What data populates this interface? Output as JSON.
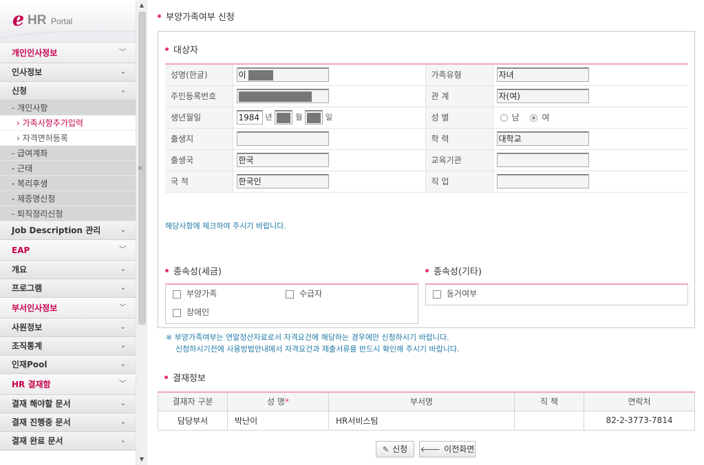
{
  "logo": {
    "e": "e",
    "hr": "HR",
    "portal": "Portal"
  },
  "sidebar": {
    "groups": [
      {
        "label": "개인인사정보",
        "chevron": "chevron-down-icon"
      },
      {
        "label": "인사정보",
        "chevron": "chevron-down-icon"
      },
      {
        "label": "신청",
        "chevron": "chevron-down-icon"
      }
    ],
    "apply_subs": [
      {
        "label": "- 개인사항"
      }
    ],
    "apply_sub2": [
      {
        "label": "› 가족사항추가입력"
      },
      {
        "label": "› 자격면허등록"
      }
    ],
    "apply_subs2": [
      {
        "label": "- 급여계좌"
      },
      {
        "label": "- 근태"
      },
      {
        "label": "- 복리후생"
      },
      {
        "label": "- 제증명신청"
      },
      {
        "label": "- 퇴직정리신청"
      }
    ],
    "rest": [
      {
        "label": "Job Description 관리",
        "hl": false
      },
      {
        "label": "EAP",
        "hl": true
      },
      {
        "label": "개요",
        "hl": false
      },
      {
        "label": "프로그램",
        "hl": false
      },
      {
        "label": "부서인사정보",
        "hl": true
      },
      {
        "label": "사원정보",
        "hl": false
      },
      {
        "label": "조직통계",
        "hl": false
      },
      {
        "label": "인재Pool",
        "hl": false
      },
      {
        "label": "HR 결재함",
        "hl": true
      },
      {
        "label": "결재 해야할 문서",
        "hl": false
      },
      {
        "label": "결재 진행중 문서",
        "hl": false
      },
      {
        "label": "결재 완료 문서",
        "hl": false
      }
    ]
  },
  "page_title": "부양가족여부 신청",
  "target": {
    "title": "대상자",
    "name_label": "성명(한글)",
    "name_value": "이",
    "family_type_label": "가족유형",
    "family_type_value": "자녀",
    "rrn_label": "주민등록번호",
    "relation_label": "관 계",
    "relation_value": "자(여)",
    "birth_label": "생년월일",
    "birth_year": "1984",
    "year_unit": "년",
    "month_unit": "월",
    "day_unit": "일",
    "gender_label": "성 별",
    "gender_male": "남",
    "gender_female": "여",
    "gender_selected": "여",
    "birthplace_label": "출생지",
    "birthplace_value": "",
    "education_label": "학 력",
    "education_value": "대학교",
    "birth_country_label": "출생국",
    "birth_country_value": "한국",
    "school_label": "교육기관",
    "school_value": "",
    "nationality_label": "국 적",
    "nationality_value": "한국인",
    "job_label": "직 업",
    "job_value": ""
  },
  "notice": "해당사항에 체크하여 주시기 바랍니다.",
  "dependency_tax": {
    "title": "종속성(세금)",
    "items": [
      "부양가족",
      "수급자",
      "장애인"
    ]
  },
  "dependency_other": {
    "title": "종속성(기타)",
    "items": [
      "동거여부"
    ]
  },
  "footnote": {
    "line1": "※ 부양가족여부는 연말정산자료로서 자격요건에 해당하는 경우에만 신청하시기 바랍니다.",
    "line2": "신청하시기전에 사용방법안내에서 자격요건과 제출서류를 반드시 확인해 주시기 바랍니다."
  },
  "approval": {
    "title": "결재정보",
    "headers": [
      "결재자 구분",
      "성 명",
      "부서명",
      "직 책",
      "연락처"
    ],
    "required_mark": "*",
    "rows": [
      [
        "담당부서",
        "박난이",
        "HR서비스팀",
        "",
        "82-2-3773-7814"
      ]
    ]
  },
  "buttons": {
    "apply": "신청",
    "back": "이전화면"
  },
  "colors": {
    "accent": "#c7004e",
    "bullet": "#e8336f",
    "notice": "#1f7aa7",
    "line": "#f0a3b8"
  }
}
